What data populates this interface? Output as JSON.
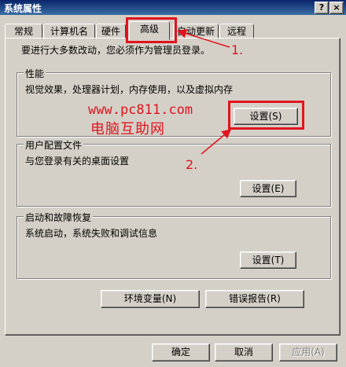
{
  "window": {
    "title": "系统属性",
    "help_label": "?",
    "close_label": "×"
  },
  "tabs": [
    {
      "label": "常规"
    },
    {
      "label": "计算机名"
    },
    {
      "label": "硬件"
    },
    {
      "label": "高级",
      "active": true
    },
    {
      "label": "自动更新"
    },
    {
      "label": "远程"
    }
  ],
  "intro": "要进行大多数改动，您必须作为管理员登录。",
  "performance": {
    "legend": "性能",
    "desc": "视觉效果，处理器计划，内存使用，以及虚拟内存",
    "button": "设置(S)"
  },
  "profiles": {
    "legend": "用户配置文件",
    "desc": "与您登录有关的桌面设置",
    "button": "设置(E)"
  },
  "startup": {
    "legend": "启动和故障恢复",
    "desc": "系统启动，系统失败和调试信息",
    "button": "设置(T)"
  },
  "env_button": "环境变量(N)",
  "error_button": "错误报告(R)",
  "footer": {
    "ok": "确定",
    "cancel": "取消",
    "apply": "应用(A)"
  },
  "annotations": {
    "step1": "1.",
    "step2": "2.",
    "watermark_url": "www.pc811.com",
    "watermark_text": "电脑互助网",
    "color": "#e0141e"
  }
}
